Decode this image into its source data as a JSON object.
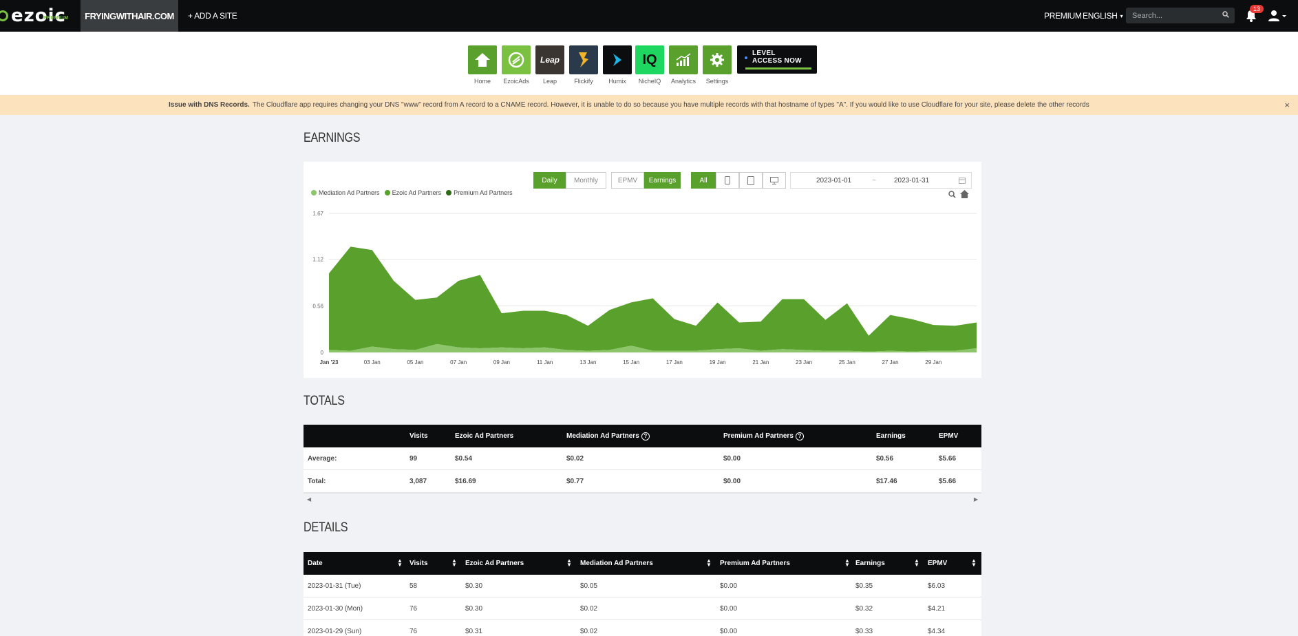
{
  "topbar": {
    "logo": "ezoic",
    "logo_sub": "PREMIUM",
    "site": "FRYINGWITHAIR.COM",
    "add_site": "+ ADD A SITE",
    "premium": "PREMIUM",
    "language": "ENGLISH",
    "search_placeholder": "Search...",
    "notifications": "13"
  },
  "apps": [
    {
      "label": "Home",
      "color": "#5aa02c"
    },
    {
      "label": "EzoicAds",
      "color": "#7ac142"
    },
    {
      "label": "Leap",
      "color": "#3a3530"
    },
    {
      "label": "Flickify",
      "color": "#2b3a4a"
    },
    {
      "label": "Humix",
      "color": "#0b0d0f"
    },
    {
      "label": "NicheIQ",
      "color": "#1ed760"
    },
    {
      "label": "Analytics",
      "color": "#5aa02c"
    },
    {
      "label": "Settings",
      "color": "#5aa02c"
    }
  ],
  "level_banner": {
    "line1": "LEVEL",
    "line2": "ACCESS NOW"
  },
  "alert": {
    "bold": "Issue with DNS Records.",
    "text": "The Cloudflare app requires changing your DNS \"www\" record from A record to a CNAME record. However, it is unable to do so because you have multiple records with that hostname of types \"A\". If you would like to use Cloudflare for your site, please delete the other records",
    "close": "×"
  },
  "sections": {
    "earnings": "EARNINGS",
    "totals": "TOTALS",
    "details": "DETAILS"
  },
  "controls": {
    "daily": "Daily",
    "monthly": "Monthly",
    "epmv": "EPMV",
    "earnings": "Earnings",
    "all": "All",
    "date_from": "2023-01-01",
    "date_sep": "~",
    "date_to": "2023-01-31"
  },
  "chart_data": {
    "type": "area",
    "title": "",
    "xlabel": "",
    "ylabel": "",
    "ylim": [
      0,
      1.67
    ],
    "yticks": [
      "0",
      "0.56",
      "1.12",
      "1.67"
    ],
    "xticks": [
      "Jan '23",
      "03 Jan",
      "05 Jan",
      "07 Jan",
      "09 Jan",
      "11 Jan",
      "13 Jan",
      "15 Jan",
      "17 Jan",
      "19 Jan",
      "21 Jan",
      "23 Jan",
      "25 Jan",
      "27 Jan",
      "29 Jan"
    ],
    "x": [
      "2023-01-01",
      "2023-01-02",
      "2023-01-03",
      "2023-01-04",
      "2023-01-05",
      "2023-01-06",
      "2023-01-07",
      "2023-01-08",
      "2023-01-09",
      "2023-01-10",
      "2023-01-11",
      "2023-01-12",
      "2023-01-13",
      "2023-01-14",
      "2023-01-15",
      "2023-01-16",
      "2023-01-17",
      "2023-01-18",
      "2023-01-19",
      "2023-01-20",
      "2023-01-21",
      "2023-01-22",
      "2023-01-23",
      "2023-01-24",
      "2023-01-25",
      "2023-01-26",
      "2023-01-27",
      "2023-01-28",
      "2023-01-29",
      "2023-01-30",
      "2023-01-31"
    ],
    "stacked": true,
    "legend_position": "top-left",
    "series": [
      {
        "name": "Mediation Ad Partners",
        "color": "#8cc56a",
        "values": [
          0.03,
          0.02,
          0.07,
          0.04,
          0.03,
          0.1,
          0.06,
          0.05,
          0.06,
          0.05,
          0.06,
          0.03,
          0.02,
          0.03,
          0.08,
          0.02,
          0.02,
          0.02,
          0.04,
          0.05,
          0.02,
          0.04,
          0.03,
          0.02,
          0.02,
          0.01,
          0.02,
          0.01,
          0.02,
          0.02,
          0.05
        ]
      },
      {
        "name": "Ezoic Ad Partners",
        "color": "#5aa02c",
        "values": [
          0.92,
          1.25,
          1.16,
          0.82,
          0.6,
          0.56,
          0.8,
          0.88,
          0.41,
          0.45,
          0.44,
          0.42,
          0.3,
          0.48,
          0.52,
          0.63,
          0.38,
          0.3,
          0.56,
          0.31,
          0.35,
          0.6,
          0.61,
          0.37,
          0.57,
          0.19,
          0.43,
          0.39,
          0.31,
          0.3,
          0.31
        ]
      },
      {
        "name": "Premium Ad Partners",
        "color": "#2f6b16",
        "values": [
          0,
          0,
          0,
          0,
          0,
          0,
          0,
          0,
          0,
          0,
          0,
          0,
          0,
          0,
          0,
          0,
          0,
          0,
          0,
          0,
          0,
          0,
          0,
          0,
          0,
          0,
          0,
          0,
          0,
          0,
          0
        ]
      }
    ]
  },
  "totals": {
    "headers": [
      "",
      "Visits",
      "Ezoic Ad Partners",
      "Mediation Ad Partners",
      "Premium Ad Partners",
      "Earnings",
      "EPMV"
    ],
    "rows": [
      [
        "Average:",
        "99",
        "$0.54",
        "$0.02",
        "$0.00",
        "$0.56",
        "$5.66"
      ],
      [
        "Total:",
        "3,087",
        "$16.69",
        "$0.77",
        "$0.00",
        "$17.46",
        "$5.66"
      ]
    ]
  },
  "details": {
    "headers": [
      "Date",
      "Visits",
      "Ezoic Ad Partners",
      "Mediation Ad Partners",
      "Premium Ad Partners",
      "Earnings",
      "EPMV"
    ],
    "rows": [
      [
        "2023-01-31 (Tue)",
        "58",
        "$0.30",
        "$0.05",
        "$0.00",
        "$0.35",
        "$6.03"
      ],
      [
        "2023-01-30 (Mon)",
        "76",
        "$0.30",
        "$0.02",
        "$0.00",
        "$0.32",
        "$4.21"
      ],
      [
        "2023-01-29 (Sun)",
        "76",
        "$0.31",
        "$0.02",
        "$0.00",
        "$0.33",
        "$4.34"
      ]
    ]
  }
}
